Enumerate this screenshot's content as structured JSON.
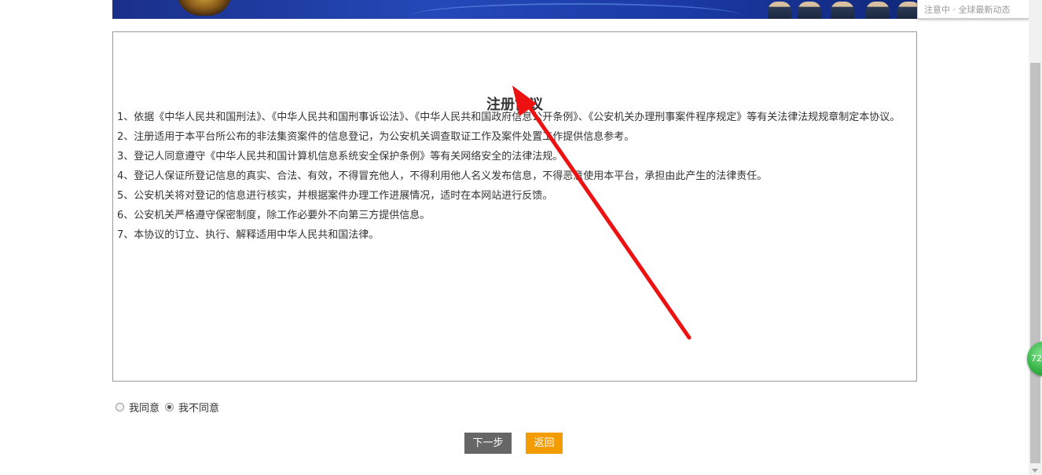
{
  "banner": {
    "tip_text": "注意中 · 全球最新动态"
  },
  "agreement": {
    "title": "注册协议",
    "clauses": [
      "1、依据《中华人民共和国刑法》、《中华人民共和国刑事诉讼法》、《中华人民共和国政府信息公开条例》、《公安机关办理刑事案件程序规定》等有关法律法规规章制定本协议。",
      "2、注册适用于本平台所公布的非法集资案件的信息登记，为公安机关调查取证工作及案件处置工作提供信息参考。",
      "3、登记人同意遵守《中华人民共和国计算机信息系统安全保护条例》等有关网络安全的法律法规。",
      "4、登记人保证所登记信息的真实、合法、有效，不得冒充他人，不得利用他人名义发布信息，不得恶意使用本平台，承担由此产生的法律责任。",
      "5、公安机关将对登记的信息进行核实，并根据案件办理工作进展情况，适时在本网站进行反馈。",
      "6、公安机关严格遵守保密制度，除工作必要外不向第三方提供信息。",
      "7、本协议的订立、执行、解释适用中华人民共和国法律。"
    ]
  },
  "consent": {
    "agree_label": "我同意",
    "disagree_label": "我不同意",
    "selected": "disagree"
  },
  "actions": {
    "next_label": "下一步",
    "back_label": "返回"
  },
  "floating_badge": {
    "text": "72"
  },
  "colors": {
    "next_button": "#666666",
    "back_button": "#f29c00",
    "annotation_arrow": "#ee1111"
  }
}
